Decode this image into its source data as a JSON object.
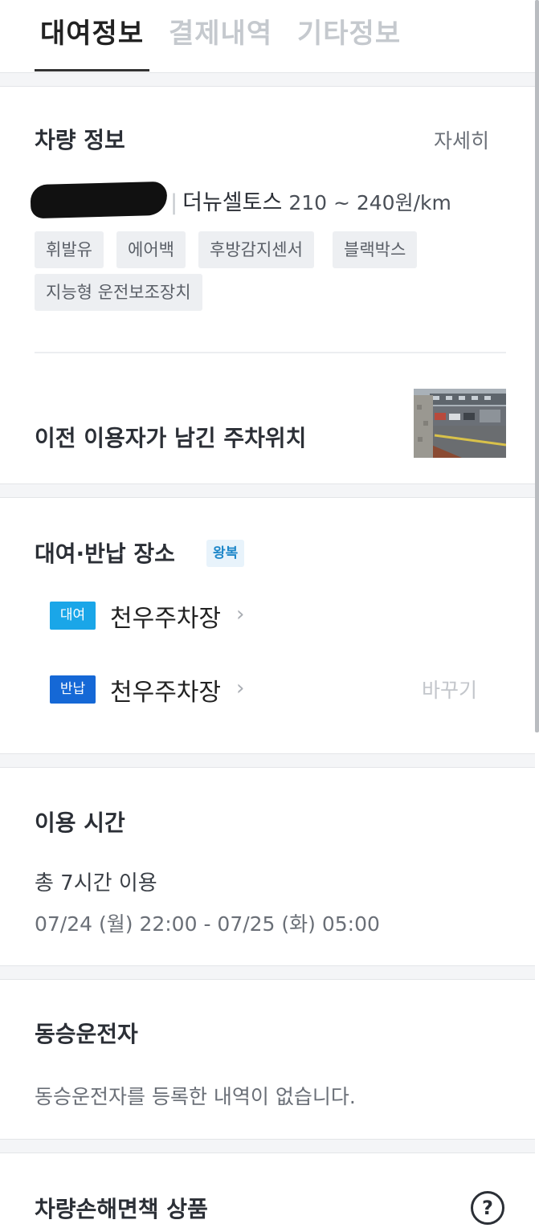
{
  "tabs": [
    {
      "label": "대여정보"
    },
    {
      "label": "결제내역"
    },
    {
      "label": "기타정보"
    }
  ],
  "vehicle": {
    "title": "차량 정보",
    "detail_link": "자세히",
    "separator": "|",
    "model": "더뉴셀토스",
    "price": "210 ~ 240원/km",
    "tags": [
      "휘발유",
      "에어백",
      "후방감지센서",
      "블랙박스",
      "지능형 운전보조장치"
    ],
    "parking_title": "이전 이용자가 남긴 주차위치"
  },
  "location": {
    "title": "대여·반납 장소",
    "round_trip_badge": "왕복",
    "pickup": {
      "badge": "대여",
      "name": "천우주차장",
      "color": "#1aa6e8"
    },
    "return": {
      "badge": "반납",
      "name": "천우주차장",
      "color": "#1568d6"
    },
    "change_label": "바꾸기",
    "chevron": "›"
  },
  "usage": {
    "title": "이용 시간",
    "total": "총 7시간 이용",
    "range": "07/24 (월) 22:00 - 07/25 (화) 05:00"
  },
  "co_driver": {
    "title": "동승운전자",
    "empty_text": "동승운전자를 등록한 내역이 없습니다."
  },
  "insurance": {
    "title": "차량손해면책 상품",
    "help_icon": "?"
  }
}
